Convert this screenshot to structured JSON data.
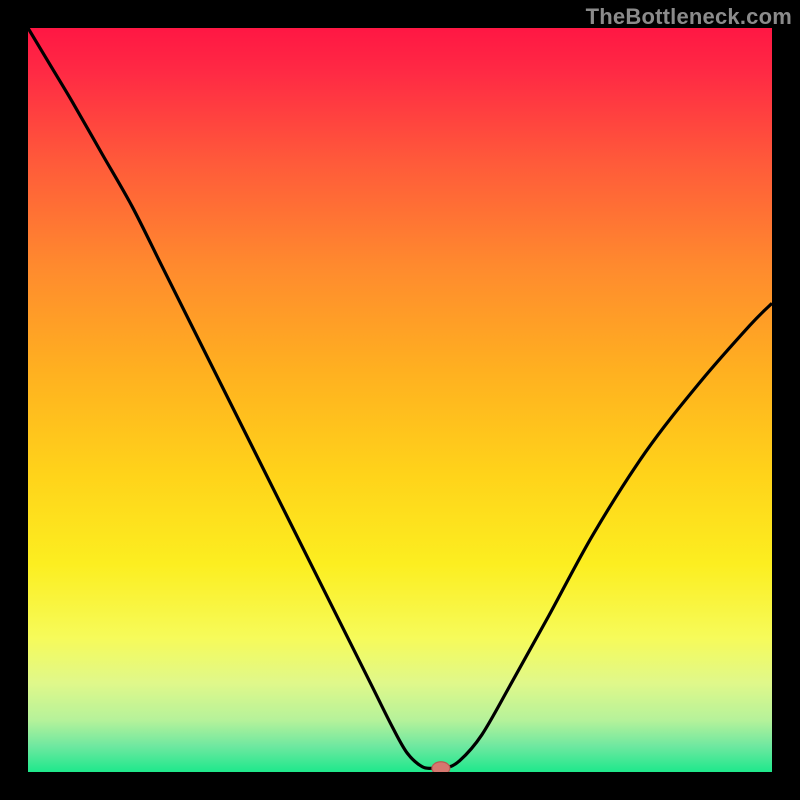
{
  "attribution": "TheBottleneck.com",
  "chart_data": {
    "type": "line",
    "title": "",
    "xlabel": "",
    "ylabel": "",
    "xlim": [
      0,
      100
    ],
    "ylim": [
      0,
      100
    ],
    "grid": false,
    "legend": false,
    "series": [
      {
        "name": "bottleneck-curve",
        "x": [
          0,
          3,
          6,
          10,
          14,
          18,
          22,
          26,
          30,
          34,
          38,
          42,
          46,
          49,
          51,
          53,
          54.5,
          56,
          58,
          61,
          65,
          70,
          76,
          83,
          90,
          97,
          100
        ],
        "y": [
          100,
          95,
          90,
          83,
          76,
          68,
          60,
          52,
          44,
          36,
          28,
          20,
          12,
          6,
          2.5,
          0.7,
          0.5,
          0.5,
          1.5,
          5,
          12,
          21,
          32,
          43,
          52,
          60,
          63
        ]
      }
    ],
    "marker": {
      "x": 55.5,
      "y": 0.5
    },
    "background_gradient_stops": [
      {
        "offset": 0.0,
        "color": "#ff1744"
      },
      {
        "offset": 0.06,
        "color": "#ff2a44"
      },
      {
        "offset": 0.18,
        "color": "#ff5a3a"
      },
      {
        "offset": 0.32,
        "color": "#ff8a2e"
      },
      {
        "offset": 0.46,
        "color": "#ffb020"
      },
      {
        "offset": 0.6,
        "color": "#ffd31a"
      },
      {
        "offset": 0.72,
        "color": "#fcee20"
      },
      {
        "offset": 0.82,
        "color": "#f6fb5a"
      },
      {
        "offset": 0.88,
        "color": "#e0f88a"
      },
      {
        "offset": 0.93,
        "color": "#b6f29a"
      },
      {
        "offset": 0.965,
        "color": "#6fe8a0"
      },
      {
        "offset": 1.0,
        "color": "#1ee88c"
      }
    ],
    "colors": {
      "curve": "#000000",
      "marker_fill": "#d6776f",
      "marker_stroke": "#b85a52"
    }
  }
}
